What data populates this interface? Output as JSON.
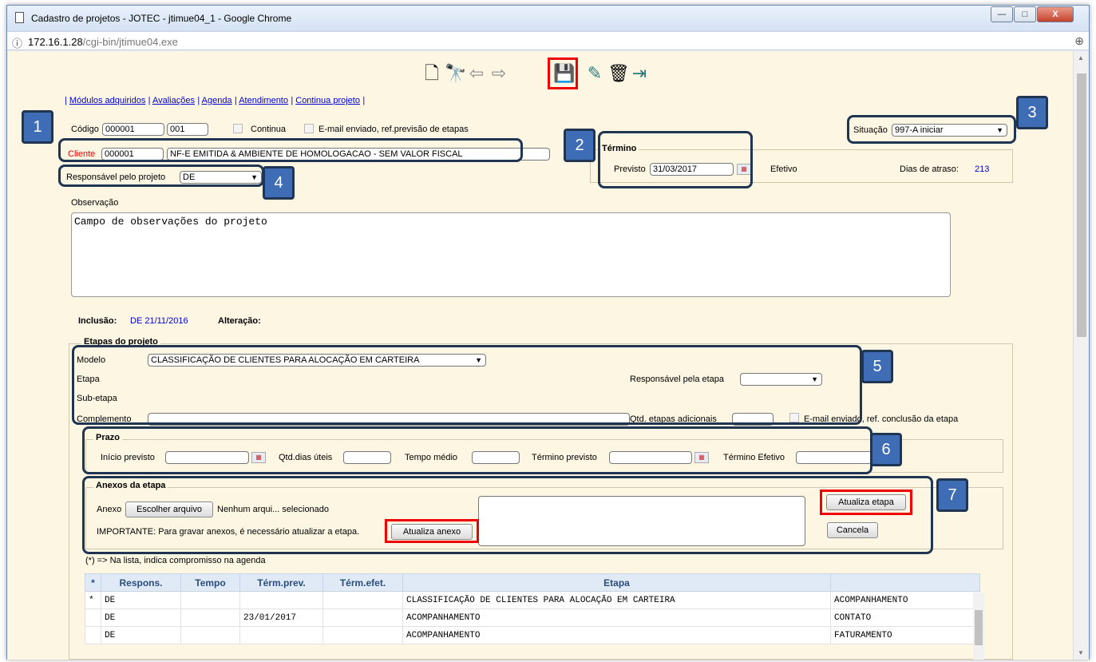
{
  "window": {
    "title": "Cadastro de projetos - JOTEC - jtimue04_1 - Google Chrome",
    "min": "—",
    "max": "□",
    "close": "X"
  },
  "address": {
    "info": "ⓘ",
    "host": "172.16.1.28",
    "path": "/cgi-bin/jtimue04.exe",
    "zoom": "⊕"
  },
  "toolbar": {
    "icons": [
      "new-document-icon",
      "binoculars-search-icon",
      "arrow-left-icon",
      "arrow-right-icon",
      "save-icon",
      "edit-icon",
      "trash-icon",
      "exit-icon"
    ]
  },
  "links": [
    "Módulos adquiridos",
    "Avaliações",
    "Agenda",
    "Atendimento",
    "Continua projeto"
  ],
  "form": {
    "codigo_label": "Código",
    "codigo1": "000001",
    "codigo2": "001",
    "continua": "Continua",
    "email_prev": "E-mail enviado, ref.previsão de etapas",
    "situacao_label": "Situação",
    "situacao": "997-A iniciar",
    "cliente_label": "Cliente",
    "cliente_code": "000001",
    "cliente_name": "NF-E EMITIDA & AMBIENTE DE HOMOLOGACAO - SEM VALOR FISCAL",
    "termino_legend": "Término",
    "previsto_label": "Previsto",
    "previsto": "31/03/2017",
    "efetivo_label": "Efetivo",
    "dias_label": "Dias de atraso:",
    "dias": "213",
    "resp_label": "Responsável pelo projeto",
    "resp": "DE",
    "obs_label": "Observação",
    "obs": "Campo de observações do projeto",
    "inclusao_label": "Inclusão:",
    "inclusao": "DE  21/11/2016",
    "alteracao_label": "Alteração:"
  },
  "etapas": {
    "legend": "Etapas do projeto",
    "modelo_label": "Modelo",
    "modelo": "CLASSIFICAÇÃO DE CLIENTES PARA ALOCAÇÃO EM CARTEIRA",
    "etapa_label": "Etapa",
    "resp_etapa_label": "Responsável pela etapa",
    "subetapa_label": "Sub-etapa",
    "complemento_label": "Complemento",
    "qtd_label": "Qtd. etapas adicionais",
    "email_conc": "E-mail enviado, ref. conclusão da etapa"
  },
  "prazo": {
    "legend": "Prazo",
    "inicio": "Início previsto",
    "qtd_dias": "Qtd.dias úteis",
    "tempo": "Tempo médio",
    "termino_prev": "Término previsto",
    "termino_efet": "Término Efetivo"
  },
  "anexos": {
    "legend": "Anexos da etapa",
    "anexo_label": "Anexo",
    "choose": "Escolher arquivo",
    "none": "Nenhum arqui... selecionado",
    "important": "IMPORTANTE: Para gravar anexos, é necessário atualizar a etapa.",
    "atualiza_anexo": "Atualiza anexo",
    "atualiza_etapa": "Atualiza etapa",
    "cancela": "Cancela"
  },
  "note": "(*) => Na lista, indica compromisso na agenda",
  "grid": {
    "headers": [
      "*",
      "Respons.",
      "Tempo",
      "Térm.prev.",
      "Térm.efet.",
      "Etapa",
      ""
    ],
    "rows": [
      [
        "*",
        "DE",
        "",
        "",
        "",
        "CLASSIFICAÇÃO DE CLIENTES PARA ALOCAÇÃO EM CARTEIRA",
        "ACOMPANHAMENTO"
      ],
      [
        "",
        "DE",
        "",
        "23/01/2017",
        "",
        "ACOMPANHAMENTO",
        "CONTATO"
      ],
      [
        "",
        "DE",
        "",
        "",
        "",
        "ACOMPANHAMENTO",
        "FATURAMENTO"
      ]
    ]
  },
  "badges": [
    "1",
    "2",
    "3",
    "4",
    "5",
    "6",
    "7"
  ]
}
